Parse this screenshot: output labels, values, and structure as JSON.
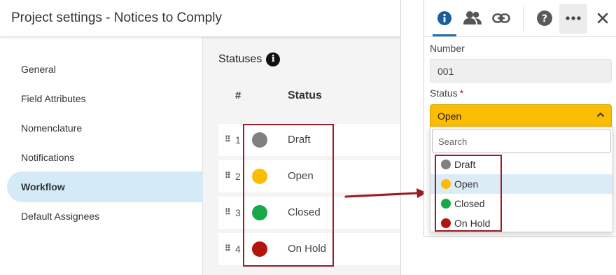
{
  "left_window": {
    "title": "Project settings - Notices to Comply",
    "sidebar": {
      "items": [
        {
          "label": "General"
        },
        {
          "label": "Field Attributes"
        },
        {
          "label": "Nomenclature"
        },
        {
          "label": "Notifications"
        },
        {
          "label": "Workflow",
          "active": true
        },
        {
          "label": "Default Assignees"
        }
      ]
    },
    "statuses": {
      "title": "Statuses",
      "info_icon": "info-icon",
      "headers": {
        "number": "#",
        "status": "Status"
      },
      "rows": [
        {
          "number": "1",
          "label": "Draft",
          "color": "#808080"
        },
        {
          "number": "2",
          "label": "Open",
          "color": "#fbbc04"
        },
        {
          "number": "3",
          "label": "Closed",
          "color": "#17a84a"
        },
        {
          "number": "4",
          "label": "On Hold",
          "color": "#b4140e"
        }
      ]
    }
  },
  "right_panel": {
    "tabs": [
      {
        "icon": "info-icon",
        "active": true
      },
      {
        "icon": "people-icon"
      },
      {
        "icon": "link-icon"
      }
    ],
    "actions": [
      {
        "icon": "help-icon"
      },
      {
        "icon": "more-icon"
      },
      {
        "icon": "close-icon"
      }
    ],
    "number_label": "Number",
    "number_value": "001",
    "status_label": "Status",
    "status_required": "*",
    "status_value": "Open",
    "status_color": "#fbbc04",
    "dropdown": {
      "search_placeholder": "Search",
      "options": [
        {
          "label": "Draft",
          "color": "#808080"
        },
        {
          "label": "Open",
          "color": "#fbbc04",
          "selected": true
        },
        {
          "label": "Closed",
          "color": "#17a84a"
        },
        {
          "label": "On Hold",
          "color": "#b4140e"
        }
      ]
    }
  },
  "annotation_color": "#9b1c24"
}
